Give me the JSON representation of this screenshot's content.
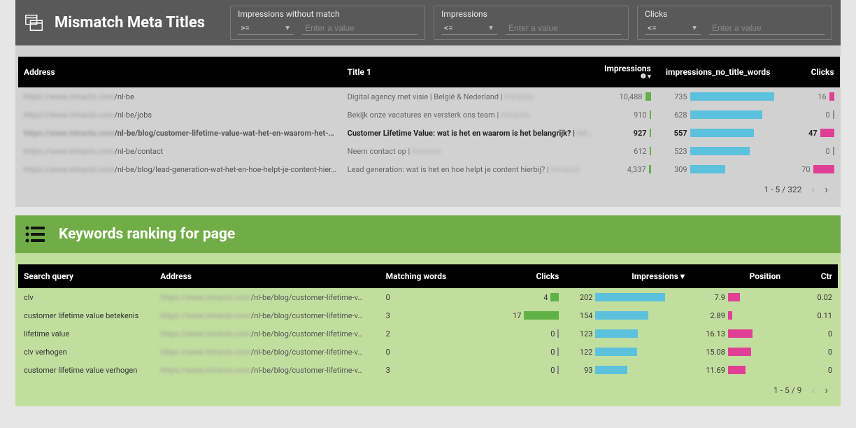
{
  "section1": {
    "title": "Mismatch Meta Titles",
    "filters": {
      "impressions_no_match": {
        "label": "Impressions without match",
        "operator": ">=",
        "placeholder": "Enter a value",
        "value": ""
      },
      "impressions": {
        "label": "Impressions",
        "operator": "<=",
        "placeholder": "Enter a value",
        "value": ""
      },
      "clicks": {
        "label": "Clicks",
        "operator": "<=",
        "placeholder": "Enter a value",
        "value": ""
      }
    },
    "columns": {
      "address": "Address",
      "title1": "Title 1",
      "impressions": "Impressions",
      "imp_no_title": "impressions_no_title_words",
      "clicks": "Clicks"
    },
    "rows": [
      {
        "host": "https://www.intracto.com",
        "path": "/nl-be",
        "title": "Digital agency met visie | België & Nederland | ",
        "title_suffix": "Intracto",
        "impressions": "10,488",
        "imp_raw": 10488,
        "notitle": "735",
        "notitle_raw": 735,
        "clicks": "16",
        "clicks_raw": 16,
        "selected": false
      },
      {
        "host": "https://www.intracto.com",
        "path": "/nl-be/jobs",
        "title": "Bekijk onze vacatures en versterk ons team | ",
        "title_suffix": "Intracto",
        "impressions": "910",
        "imp_raw": 910,
        "notitle": "628",
        "notitle_raw": 628,
        "clicks": "0",
        "clicks_raw": 0,
        "selected": false
      },
      {
        "host": "https://www.intracto.com",
        "path": "/nl-be/blog/customer-lifetime-value-wat-het-en-waarom-het-…",
        "title": "Customer Lifetime Value: wat is het en waarom is het belangrijk? | ",
        "title_suffix": "Int…",
        "impressions": "927",
        "imp_raw": 927,
        "notitle": "557",
        "notitle_raw": 557,
        "clicks": "47",
        "clicks_raw": 47,
        "selected": true
      },
      {
        "host": "https://www.intracto.com",
        "path": "/nl-be/contact",
        "title": "Neem contact op | ",
        "title_suffix": "Intracto",
        "impressions": "612",
        "imp_raw": 612,
        "notitle": "523",
        "notitle_raw": 523,
        "clicks": "0",
        "clicks_raw": 0,
        "selected": false
      },
      {
        "host": "https://www.intracto.com",
        "path": "/nl-be/blog/lead-generation-wat-het-en-hoe-helpt-je-content-hier…",
        "title": "Lead generation: wat is het en hoe helpt je content hierbij? | ",
        "title_suffix": "Intracto",
        "impressions": "4,337",
        "imp_raw": 4337,
        "notitle": "309",
        "notitle_raw": 309,
        "clicks": "70",
        "clicks_raw": 70,
        "selected": false
      }
    ],
    "pagination": "1 - 5 / 322",
    "max": {
      "imp": 10488,
      "notitle": 735,
      "clicks": 70
    }
  },
  "section2": {
    "title": "Keywords ranking for page",
    "columns": {
      "query": "Search query",
      "address": "Address",
      "matching": "Matching words",
      "clicks": "Clicks",
      "impressions": "Impressions",
      "position": "Position",
      "ctr": "Ctr"
    },
    "rows": [
      {
        "query": "clv",
        "host": "https://www.intracto.com",
        "path": "/nl-be/blog/customer-lifetime-v…",
        "matching": "0",
        "clicks": "4",
        "clicks_raw": 4,
        "impressions": "202",
        "imp_raw": 202,
        "position": "7.9",
        "pos_raw": 7.9,
        "ctr": "0.02"
      },
      {
        "query": "customer lifetime value betekenis",
        "host": "https://www.intracto.com",
        "path": "/nl-be/blog/customer-lifetime-v…",
        "matching": "3",
        "clicks": "17",
        "clicks_raw": 17,
        "impressions": "154",
        "imp_raw": 154,
        "position": "2.89",
        "pos_raw": 2.89,
        "ctr": "0.11"
      },
      {
        "query": "lifetime value",
        "host": "https://www.intracto.com",
        "path": "/nl-be/blog/customer-lifetime-v…",
        "matching": "2",
        "clicks": "0",
        "clicks_raw": 0,
        "impressions": "123",
        "imp_raw": 123,
        "position": "16.13",
        "pos_raw": 16.13,
        "ctr": "0"
      },
      {
        "query": "clv verhogen",
        "host": "https://www.intracto.com",
        "path": "/nl-be/blog/customer-lifetime-v…",
        "matching": "0",
        "clicks": "0",
        "clicks_raw": 0,
        "impressions": "122",
        "imp_raw": 122,
        "position": "15.08",
        "pos_raw": 15.08,
        "ctr": "0"
      },
      {
        "query": "customer lifetime value verhogen",
        "host": "https://www.intracto.com",
        "path": "/nl-be/blog/customer-lifetime-v…",
        "matching": "3",
        "clicks": "0",
        "clicks_raw": 0,
        "impressions": "93",
        "imp_raw": 93,
        "position": "11.69",
        "pos_raw": 11.69,
        "ctr": "0"
      }
    ],
    "pagination": "1 - 5 / 9",
    "max": {
      "clicks": 17,
      "imp": 202,
      "pos": 16.13
    }
  }
}
